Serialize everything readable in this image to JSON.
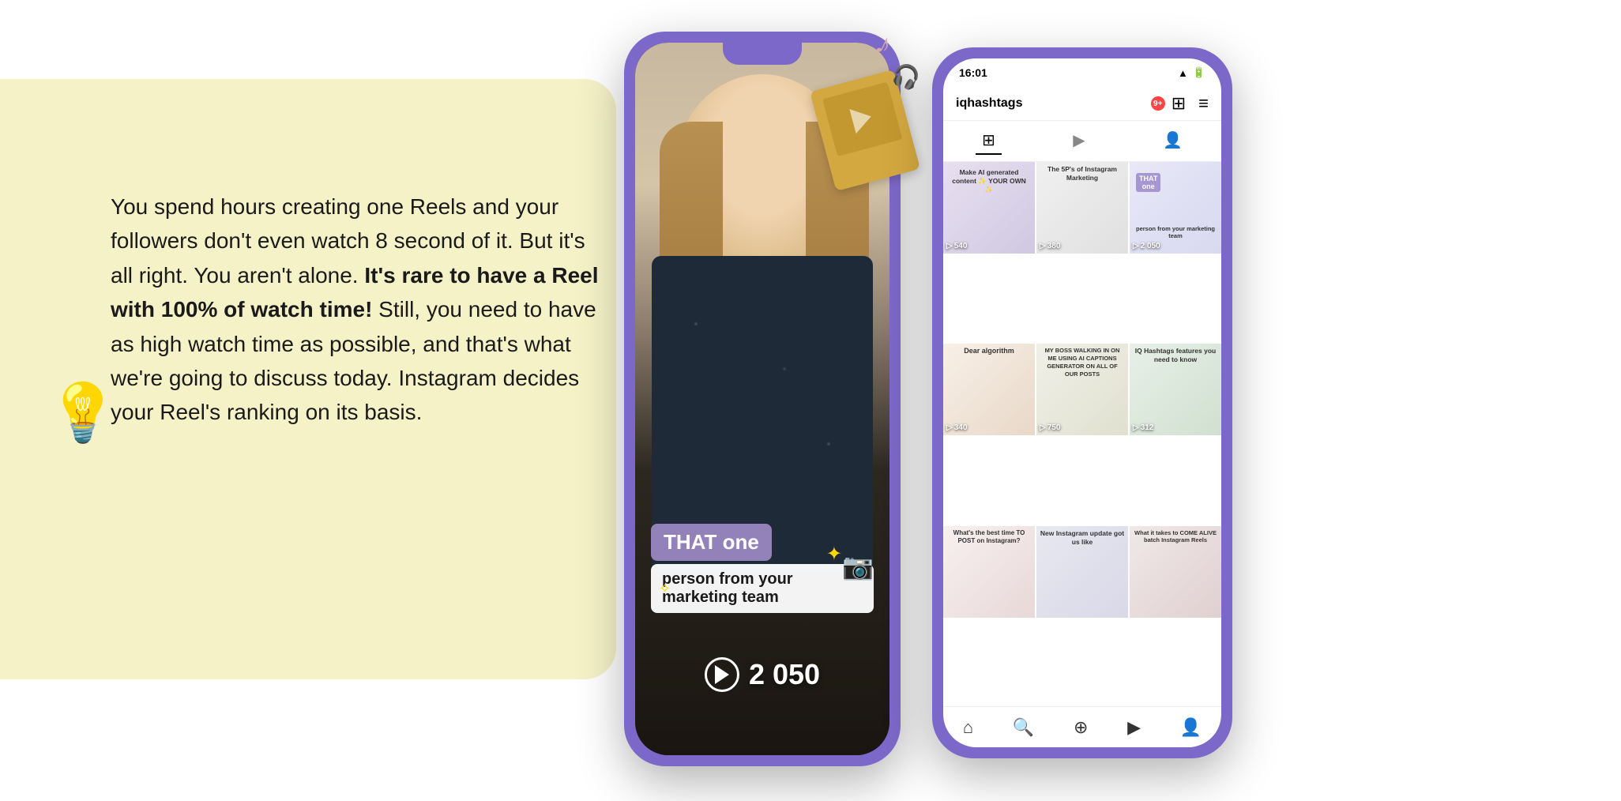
{
  "page": {
    "bg_color": "#ffffff",
    "yellow_bg_color": "#f5f2c8"
  },
  "left_content": {
    "paragraph": "You spend hours creating one Reels and your followers don't even watch 8 second of it. But it's all right. You aren't alone.",
    "bold_part": "It's rare to have a Reel with 100% of watch time!",
    "paragraph2": "Still, you need to have as high watch time as possible, and that's  what we're going to discuss today. Instagram decides your Reel's ranking on its basis.",
    "bulb_emoji": "💡"
  },
  "phone1": {
    "that_one_label": "THAT one",
    "marketing_team_label": "person from your marketing team",
    "play_count": "2 050",
    "play_icon": "▷"
  },
  "phone2": {
    "status_time": "16:01",
    "username": "iqhashtags",
    "notif_count": "9+",
    "grid_items": [
      {
        "id": 1,
        "text": "Make AI generated content ✨ YOUR OWN ✨",
        "count": "540",
        "color_class": "gc1"
      },
      {
        "id": 2,
        "text": "The 5P's of Instagram Marketing",
        "count": "380",
        "color_class": "gc2"
      },
      {
        "id": 3,
        "text": "THAT one person from your marketing team",
        "count": "2 050",
        "color_class": "gc3",
        "has_badge": true
      },
      {
        "id": 4,
        "text": "Dear algorithm",
        "count": "340",
        "color_class": "gc4"
      },
      {
        "id": 5,
        "text": "MY BOSS WALKING IN ON ME USING AI CAPTIONS GENERATOR ON ALL OF OUR POSTS",
        "count": "750",
        "color_class": "gc5"
      },
      {
        "id": 6,
        "text": "IQ Hashtags features you need to know",
        "count": "312",
        "color_class": "gc6"
      },
      {
        "id": 7,
        "text": "What's the best time TO POST on Instagram?",
        "count": "",
        "color_class": "gc7"
      },
      {
        "id": 8,
        "text": "New Instagram update got us like",
        "count": "",
        "color_class": "gc8"
      },
      {
        "id": 9,
        "text": "What it takes to COME ALIVE batch Instagram Reels",
        "count": "",
        "color_class": "gc9"
      }
    ]
  }
}
